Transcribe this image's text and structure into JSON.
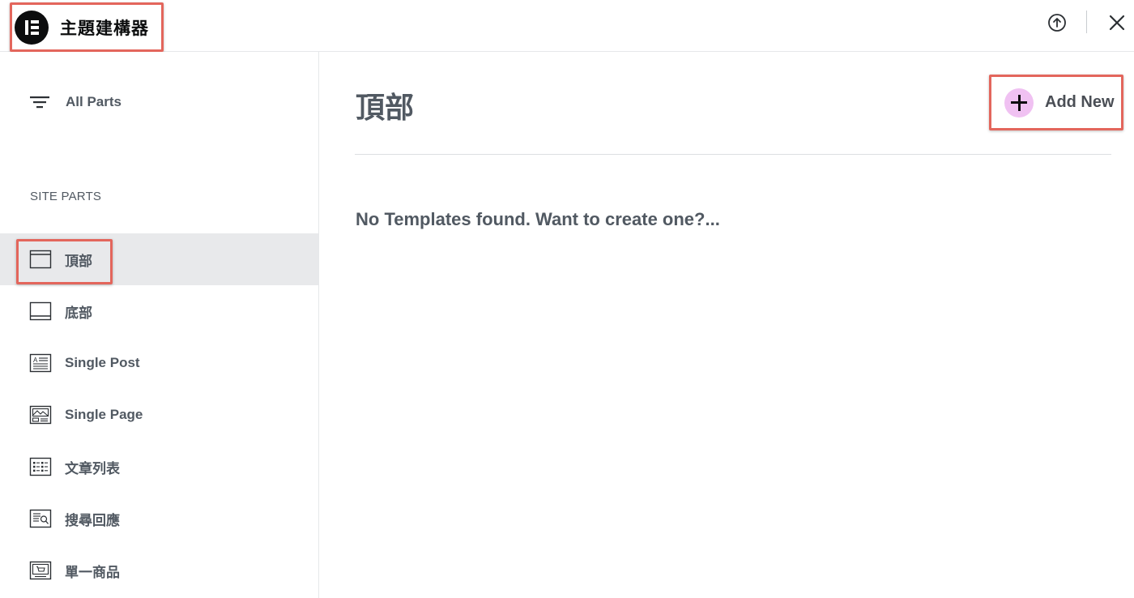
{
  "header": {
    "title": "主題建構器",
    "logo_icon": "elementor-logo-icon",
    "upload_icon": "upload-icon",
    "close_icon": "close-icon"
  },
  "sidebar": {
    "all_parts_label": "All Parts",
    "section_title": "SITE PARTS",
    "items": [
      {
        "label": "頂部",
        "icon": "header-icon",
        "active": true
      },
      {
        "label": "底部",
        "icon": "footer-icon",
        "active": false
      },
      {
        "label": "Single Post",
        "icon": "single-post-icon",
        "active": false
      },
      {
        "label": "Single Page",
        "icon": "single-page-icon",
        "active": false
      },
      {
        "label": "文章列表",
        "icon": "archive-icon",
        "active": false
      },
      {
        "label": "搜尋回應",
        "icon": "search-results-icon",
        "active": false
      },
      {
        "label": "單一商品",
        "icon": "single-product-icon",
        "active": false
      }
    ]
  },
  "main": {
    "title": "頂部",
    "add_new_label": "Add New",
    "empty_message": "No Templates found. Want to create one?..."
  },
  "colors": {
    "highlight_outline": "#e3665c",
    "add_icon_bg": "#f0c1f2",
    "active_item_bg": "#e8e9eb",
    "text": "#515962"
  }
}
